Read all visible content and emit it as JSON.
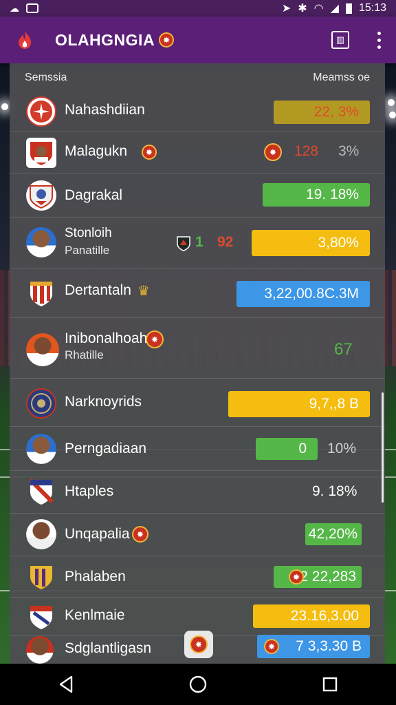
{
  "status_bar": {
    "time": "15:13",
    "icons": [
      "notification-icon",
      "gallery-icon",
      "location-icon",
      "bluetooth-icon",
      "wifi-icon",
      "signal-icon",
      "battery-icon"
    ]
  },
  "app_bar": {
    "title": "OLAHGNGIA",
    "logo_icon": "flame-logo-icon",
    "actions": [
      "book-icon",
      "more-vert-icon"
    ]
  },
  "table": {
    "header_left": "Semssia",
    "header_right": "Meamss oe",
    "rows": [
      {
        "name": "Nahashdiian",
        "sub": "",
        "badge": "",
        "value": "22, 3%",
        "pill": "dim-yellow"
      },
      {
        "name": "Malagukn",
        "sub": "",
        "badge": "r",
        "value": "128",
        "extra": "3%",
        "pill": "none"
      },
      {
        "name": "Dagrakal",
        "sub": "",
        "badge": "",
        "value": "19. 18%",
        "pill": "green"
      },
      {
        "name": "Stonloih",
        "sub": "Panatille",
        "badge": "",
        "score_left": "1",
        "score_right": "92",
        "value": "3,80%",
        "pill": "yellow"
      },
      {
        "name": "Dertantaln",
        "sub": "",
        "badge": "gold",
        "value": "3,22,00.8C.3M",
        "pill": "blue"
      },
      {
        "name": "Inibonalhoah",
        "sub": "Rhatille",
        "badge": "r",
        "value": "67",
        "pill": "none-green"
      },
      {
        "name": "Narknoyrids",
        "sub": "",
        "badge": "",
        "value": "9,7,,8 B",
        "pill": "yellow"
      },
      {
        "name": "Perngadiaan",
        "sub": "",
        "badge": "",
        "value": "0",
        "extra": "10%",
        "pill": "green"
      },
      {
        "name": "Htaples",
        "sub": "",
        "badge": "",
        "value": "9. 18%",
        "pill": "none"
      },
      {
        "name": "Unqapalia",
        "sub": "",
        "badge": "r",
        "value": "42,20%",
        "pill": "green"
      },
      {
        "name": "Phalaben",
        "sub": "",
        "badge": "",
        "value": "2 22,283",
        "pill": "green"
      },
      {
        "name": "Kenlmaie",
        "sub": "",
        "badge": "",
        "value": "23.16,3.00",
        "pill": "yellow"
      },
      {
        "name": "Sdglantligasn",
        "sub": "",
        "badge": "",
        "value": "7 3,3.30 B",
        "pill": "blue"
      }
    ]
  },
  "navigation": [
    "back-icon",
    "home-icon",
    "recents-icon"
  ],
  "colors": {
    "app_bar": "#5b1f78",
    "status_bar": "#4a1f5e",
    "panel": "#4e4e52",
    "yellow": "#f4bd10",
    "green": "#55b748",
    "blue": "#3d96e6",
    "red": "#e14a2a"
  }
}
